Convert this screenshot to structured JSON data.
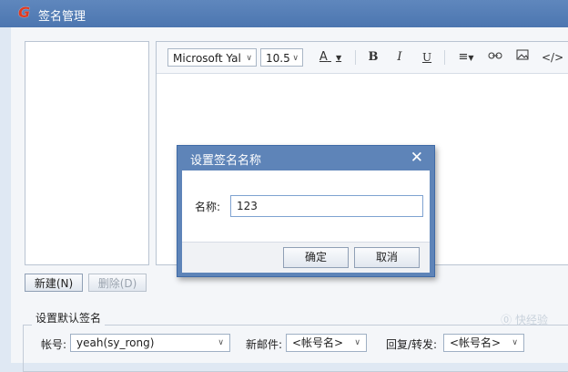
{
  "window": {
    "title": "签名管理"
  },
  "toolbar": {
    "font": "Microsoft Yal",
    "size": "10.5",
    "font_color_label": "A",
    "bold_label": "B",
    "italic_label": "I",
    "underline_label": "U"
  },
  "list_buttons": {
    "new_label": "新建(N)",
    "delete_label": "删除(D)"
  },
  "defaults": {
    "group_label": "设置默认签名",
    "account_label": "帐号:",
    "account_value": "yeah(sy_rong)",
    "new_mail_label": "新邮件:",
    "new_mail_value": "<帐号名>",
    "reply_label": "回复/转发:",
    "reply_value": "<帐号名>"
  },
  "dialog": {
    "title": "设置签名名称",
    "name_label": "名称:",
    "name_value": "123",
    "ok_label": "确定",
    "cancel_label": "取消"
  },
  "watermark": {
    "text": "⓪ 快经验"
  }
}
